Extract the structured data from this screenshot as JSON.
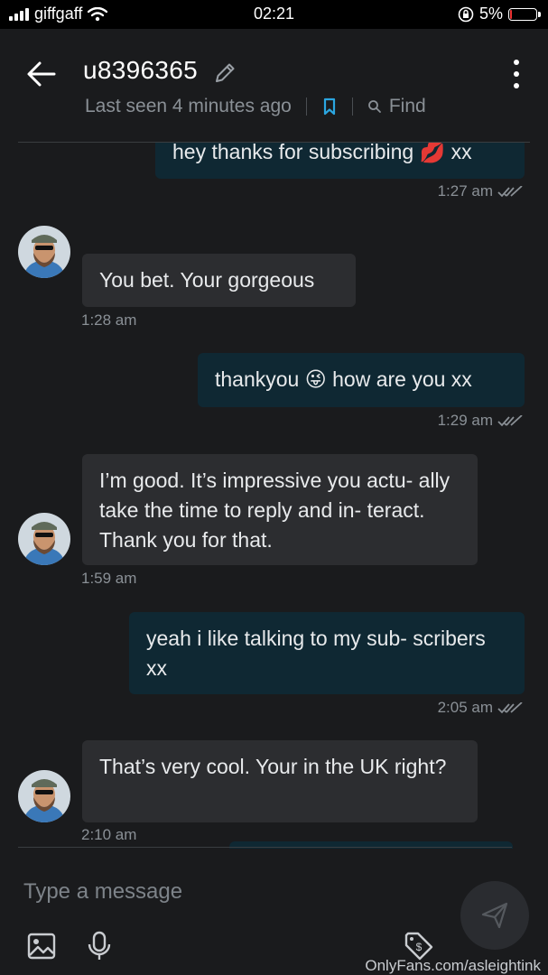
{
  "status": {
    "carrier": "giffgaff",
    "time": "02:21",
    "battery": "5%",
    "battery_level": 0.05
  },
  "header": {
    "username": "u8396365",
    "last_seen": "Last seen 4 minutes ago",
    "find_label": "Find"
  },
  "messages": [
    {
      "dir": "out",
      "text": "hey thanks for subscribing 💋 xx",
      "time": "1:27 am"
    },
    {
      "dir": "in",
      "text": "You bet. Your gorgeous",
      "time": "1:28 am"
    },
    {
      "dir": "out",
      "text": "thankyou 😜 how are you xx",
      "time": "1:29 am"
    },
    {
      "dir": "in",
      "text": "I’m good. It’s impressive you actu- ally take the time to reply and in- teract. Thank you for that.",
      "time": "1:59 am"
    },
    {
      "dir": "out",
      "text": "yeah i like talking to my sub- scribers xx",
      "time": "2:05 am"
    },
    {
      "dir": "in",
      "text": "That’s very cool. Your in the UK right?",
      "time": "2:10 am"
    }
  ],
  "composer": {
    "placeholder": "Type a message"
  },
  "watermark": "OnlyFans.com/asleightink",
  "colors": {
    "app_bg": "#1a1b1d",
    "outgoing_bubble": "#0f2833",
    "incoming_bubble": "#2c2d30",
    "muted_text": "#8a9096"
  }
}
